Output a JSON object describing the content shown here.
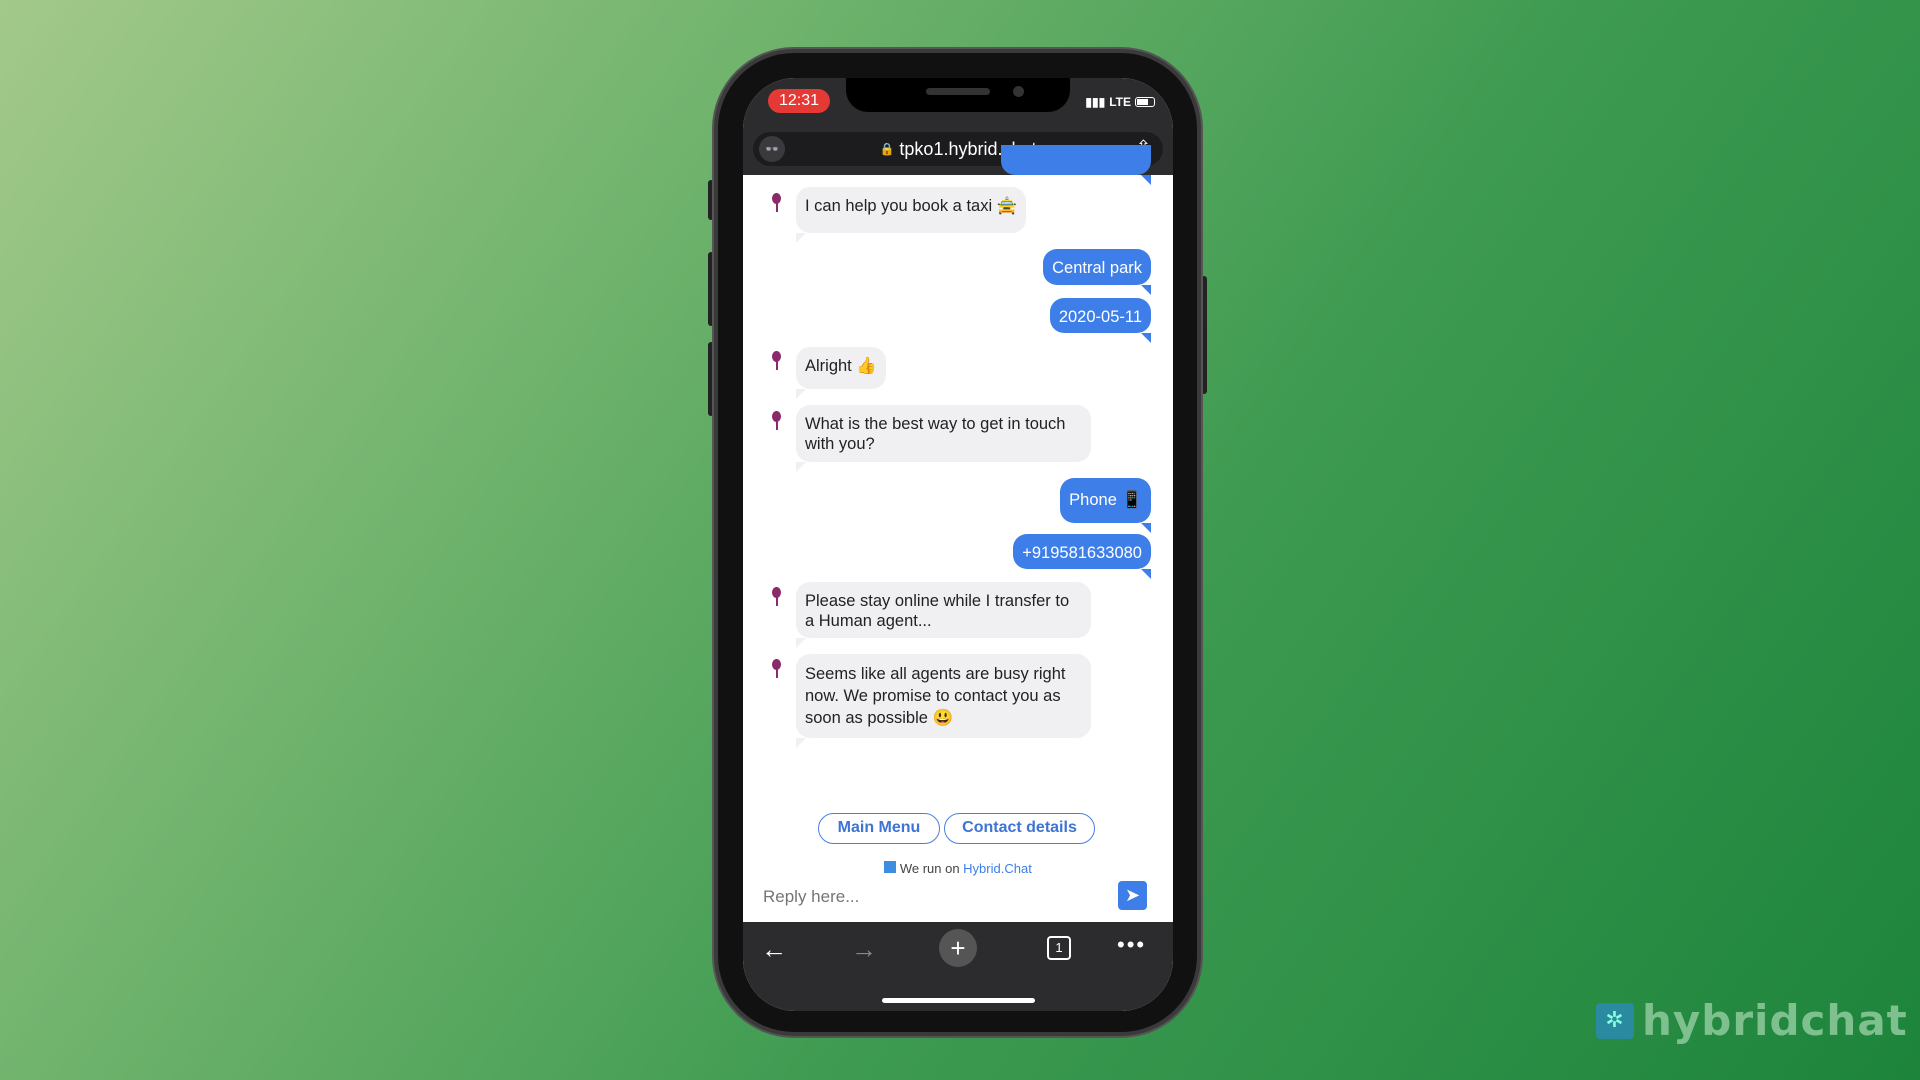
{
  "status_bar": {
    "time": "12:31",
    "network": "LTE"
  },
  "browser": {
    "url": "tpko1.hybrid.chat",
    "tab_count": "1"
  },
  "messages": [
    {
      "from": "bot",
      "text": "I can help you book a taxi 🚖"
    },
    {
      "from": "user",
      "text": "Central park"
    },
    {
      "from": "user",
      "text": "2020-05-11"
    },
    {
      "from": "bot",
      "text": "Alright 👍"
    },
    {
      "from": "bot",
      "text": "What is the best way to get in touch with you?"
    },
    {
      "from": "user",
      "text": "Phone 📱"
    },
    {
      "from": "user",
      "text": "+919581633080"
    },
    {
      "from": "bot",
      "text": "Please stay online while I transfer to a Human agent..."
    },
    {
      "from": "bot",
      "text": "Seems like all agents are busy right now. We promise to contact you as soon as possible 😃"
    }
  ],
  "quick_replies": [
    "Main Menu",
    "Contact details"
  ],
  "powered": {
    "prefix": "We run on ",
    "link": "Hybrid.Chat"
  },
  "composer": {
    "placeholder": "Reply here..."
  },
  "watermark": {
    "text": "hybridchat"
  },
  "colors": {
    "accent": "#3d7ee8",
    "bot_bubble": "#f0f0f2",
    "time_pill": "#e53935"
  }
}
